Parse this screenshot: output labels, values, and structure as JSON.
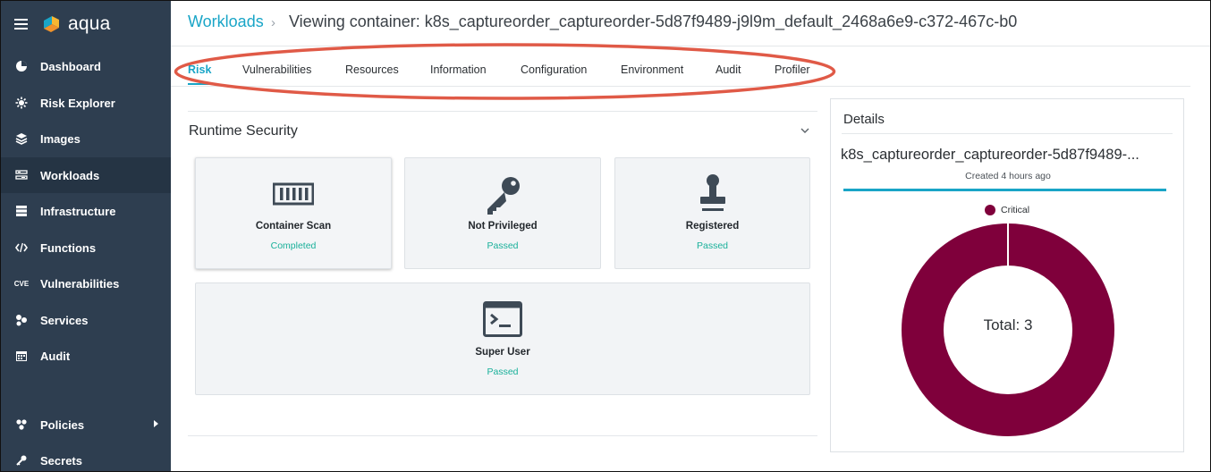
{
  "brand": {
    "name": "aqua"
  },
  "sidebar": {
    "items": [
      {
        "label": "Dashboard",
        "icon": "dashboard-icon"
      },
      {
        "label": "Risk Explorer",
        "icon": "risk-explorer-icon"
      },
      {
        "label": "Images",
        "icon": "layers-icon"
      },
      {
        "label": "Workloads",
        "icon": "workloads-icon",
        "active": true
      },
      {
        "label": "Infrastructure",
        "icon": "server-icon"
      },
      {
        "label": "Functions",
        "icon": "code-icon"
      },
      {
        "label": "Vulnerabilities",
        "icon": "cve-icon",
        "icon_text": "CVE"
      },
      {
        "label": "Services",
        "icon": "services-icon"
      },
      {
        "label": "Audit",
        "icon": "calendar-icon"
      },
      {
        "label": "Policies",
        "icon": "policies-icon",
        "has_submenu": true
      },
      {
        "label": "Secrets",
        "icon": "key-icon"
      }
    ]
  },
  "header": {
    "breadcrumb_link": "Workloads",
    "breadcrumb_separator": "›",
    "title": "Viewing container: k8s_captureorder_captureorder-5d87f9489-j9l9m_default_2468a6e9-c372-467c-b0"
  },
  "tabs": [
    {
      "label": "Risk",
      "active": true
    },
    {
      "label": "Vulnerabilities"
    },
    {
      "label": "Resources"
    },
    {
      "label": "Information"
    },
    {
      "label": "Configuration"
    },
    {
      "label": "Environment"
    },
    {
      "label": "Audit"
    },
    {
      "label": "Profiler"
    }
  ],
  "runtime_security": {
    "title": "Runtime Security",
    "cards": [
      {
        "title": "Container Scan",
        "status": "Completed",
        "icon": "container-icon"
      },
      {
        "title": "Not Privileged",
        "status": "Passed",
        "icon": "key-icon"
      },
      {
        "title": "Registered",
        "status": "Passed",
        "icon": "stamp-icon"
      },
      {
        "title": "Super User",
        "status": "Passed",
        "icon": "terminal-icon"
      }
    ]
  },
  "details": {
    "title": "Details",
    "name": "k8s_captureorder_captureorder-5d87f9489-...",
    "created": "Created 4 hours ago",
    "legend": "Critical",
    "total_label": "Total: 3",
    "segments": [
      {
        "name": "Critical",
        "value": 3,
        "color": "#7f003b"
      }
    ]
  },
  "colors": {
    "accent": "#19a5c7",
    "sidebar": "#2e3e50",
    "status_ok": "#19b09a",
    "critical": "#7f003b",
    "annotation": "#e05a47"
  }
}
